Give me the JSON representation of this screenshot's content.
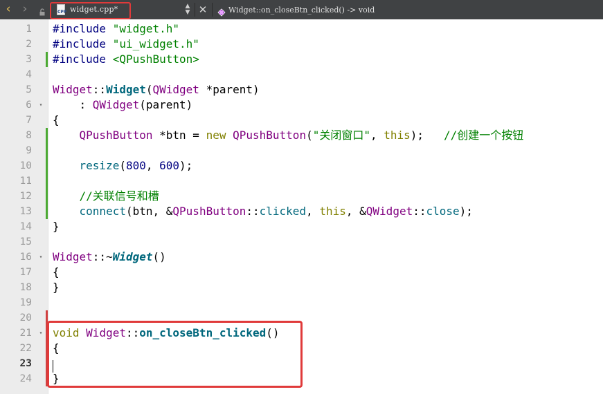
{
  "toolbar": {
    "back_icon": "chevron-left-icon",
    "forward_icon": "chevron-right-icon",
    "lock_icon": "lock-icon",
    "file_icon_text": "CPP",
    "file_name": "widget.cpp*",
    "dropdown_icon": "updown-arrows-icon",
    "close_icon": "close-icon",
    "symbol_label": "Widget::on_closeBtn_clicked() -> void",
    "highlight_color": "#e03a3a"
  },
  "gutter": {
    "current_line": 23,
    "lines": [
      {
        "n": "1",
        "fold": "",
        "mark": ""
      },
      {
        "n": "2",
        "fold": "",
        "mark": ""
      },
      {
        "n": "3",
        "fold": "",
        "mark": "changed"
      },
      {
        "n": "4",
        "fold": "",
        "mark": ""
      },
      {
        "n": "5",
        "fold": "",
        "mark": ""
      },
      {
        "n": "6",
        "fold": "▾",
        "mark": ""
      },
      {
        "n": "7",
        "fold": "",
        "mark": ""
      },
      {
        "n": "8",
        "fold": "",
        "mark": "changed"
      },
      {
        "n": "9",
        "fold": "",
        "mark": "changed"
      },
      {
        "n": "10",
        "fold": "",
        "mark": "changed"
      },
      {
        "n": "11",
        "fold": "",
        "mark": "changed"
      },
      {
        "n": "12",
        "fold": "",
        "mark": "changed"
      },
      {
        "n": "13",
        "fold": "",
        "mark": "changed"
      },
      {
        "n": "14",
        "fold": "",
        "mark": ""
      },
      {
        "n": "15",
        "fold": "",
        "mark": ""
      },
      {
        "n": "16",
        "fold": "▾",
        "mark": ""
      },
      {
        "n": "17",
        "fold": "",
        "mark": ""
      },
      {
        "n": "18",
        "fold": "",
        "mark": ""
      },
      {
        "n": "19",
        "fold": "",
        "mark": ""
      },
      {
        "n": "20",
        "fold": "",
        "mark": "unsaved"
      },
      {
        "n": "21",
        "fold": "▾",
        "mark": "unsaved"
      },
      {
        "n": "22",
        "fold": "",
        "mark": "unsaved"
      },
      {
        "n": "23",
        "fold": "",
        "mark": "unsaved"
      },
      {
        "n": "24",
        "fold": "",
        "mark": "unsaved"
      }
    ]
  },
  "code": {
    "lines": [
      [
        [
          "prep",
          "#include "
        ],
        [
          "str",
          "\"widget.h\""
        ]
      ],
      [
        [
          "prep",
          "#include "
        ],
        [
          "str",
          "\"ui_widget.h\""
        ]
      ],
      [
        [
          "prep",
          "#include "
        ],
        [
          "str",
          "<QPushButton>"
        ]
      ],
      [],
      [
        [
          "ty",
          "Widget"
        ],
        [
          "",
          "::"
        ],
        [
          "fnb",
          "Widget"
        ],
        [
          "",
          "("
        ],
        [
          "ty",
          "QWidget"
        ],
        [
          "",
          " *parent)"
        ]
      ],
      [
        [
          "",
          "    : "
        ],
        [
          "ty",
          "QWidget"
        ],
        [
          "",
          "(parent)"
        ]
      ],
      [
        [
          "",
          "{"
        ]
      ],
      [
        [
          "",
          "    "
        ],
        [
          "ty",
          "QPushButton"
        ],
        [
          "",
          " *btn = "
        ],
        [
          "kw",
          "new"
        ],
        [
          "",
          " "
        ],
        [
          "ty",
          "QPushButton"
        ],
        [
          "",
          "("
        ],
        [
          "str",
          "\"关闭窗口\""
        ],
        [
          "",
          ", "
        ],
        [
          "kw",
          "this"
        ],
        [
          "",
          ");   "
        ],
        [
          "cmt",
          "//创建一个按钮"
        ]
      ],
      [],
      [
        [
          "",
          "    "
        ],
        [
          "fn",
          "resize"
        ],
        [
          "",
          "("
        ],
        [
          "num",
          "800"
        ],
        [
          "",
          ", "
        ],
        [
          "num",
          "600"
        ],
        [
          "",
          ");"
        ]
      ],
      [],
      [
        [
          "",
          "    "
        ],
        [
          "cmt",
          "//关联信号和槽"
        ]
      ],
      [
        [
          "",
          "    "
        ],
        [
          "fn",
          "connect"
        ],
        [
          "",
          "(btn, &"
        ],
        [
          "ty",
          "QPushButton"
        ],
        [
          "",
          "::"
        ],
        [
          "fn",
          "clicked"
        ],
        [
          "",
          ", "
        ],
        [
          "kw",
          "this"
        ],
        [
          "",
          ", &"
        ],
        [
          "ty",
          "QWidget"
        ],
        [
          "",
          "::"
        ],
        [
          "fn",
          "close"
        ],
        [
          "",
          ");"
        ]
      ],
      [
        [
          "",
          "}"
        ]
      ],
      [],
      [
        [
          "ty",
          "Widget"
        ],
        [
          "",
          "::~"
        ],
        [
          "fni",
          "Widget"
        ],
        [
          "",
          "()"
        ]
      ],
      [
        [
          "",
          "{"
        ]
      ],
      [
        [
          "",
          "}"
        ]
      ],
      [],
      [],
      [
        [
          "kw",
          "void"
        ],
        [
          "",
          " "
        ],
        [
          "ty",
          "Widget"
        ],
        [
          "",
          "::"
        ],
        [
          "fnb",
          "on_closeBtn_clicked"
        ],
        [
          "",
          "()"
        ]
      ],
      [
        [
          "",
          "{"
        ]
      ],
      [],
      [
        [
          "",
          "}"
        ]
      ]
    ]
  }
}
